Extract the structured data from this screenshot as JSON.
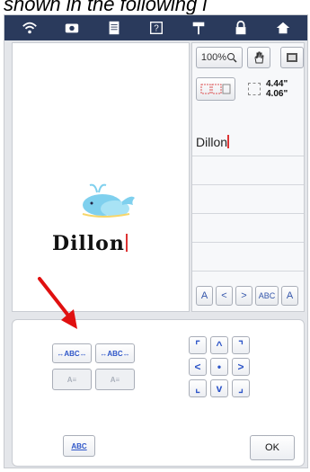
{
  "caption": "shown in the following i",
  "topbar": {
    "icons": [
      "wifi-icon",
      "camera-icon",
      "document-icon",
      "help-icon",
      "needle-icon",
      "lock-icon",
      "home-icon"
    ],
    "help_label": "?"
  },
  "preview": {
    "name_text": "Dillon"
  },
  "edit_panel": {
    "zoom_label": "100%",
    "width": "4.44\"",
    "height": "4.06\"",
    "lines": [
      "Dillon",
      "",
      "",
      "",
      "",
      ""
    ],
    "nav": {
      "font_label": "A",
      "prev_label": "<",
      "next_label": ">",
      "abc_label": "ABC",
      "a_label": "A"
    }
  },
  "bottom": {
    "btn_abc_1": "ABC",
    "btn_abc_2": "ABC",
    "btn_a_1": "A",
    "btn_a_2": "A",
    "small_abc": "ABC",
    "ok_label": "OK",
    "dpad": [
      "⌜",
      "^",
      "⌝",
      "<",
      "•",
      ">",
      "⌞",
      "v",
      "⌟"
    ]
  },
  "colors": {
    "topbar": "#2a3a5c",
    "accent_blue": "#2d55c8",
    "arrow_red": "#e01010"
  }
}
